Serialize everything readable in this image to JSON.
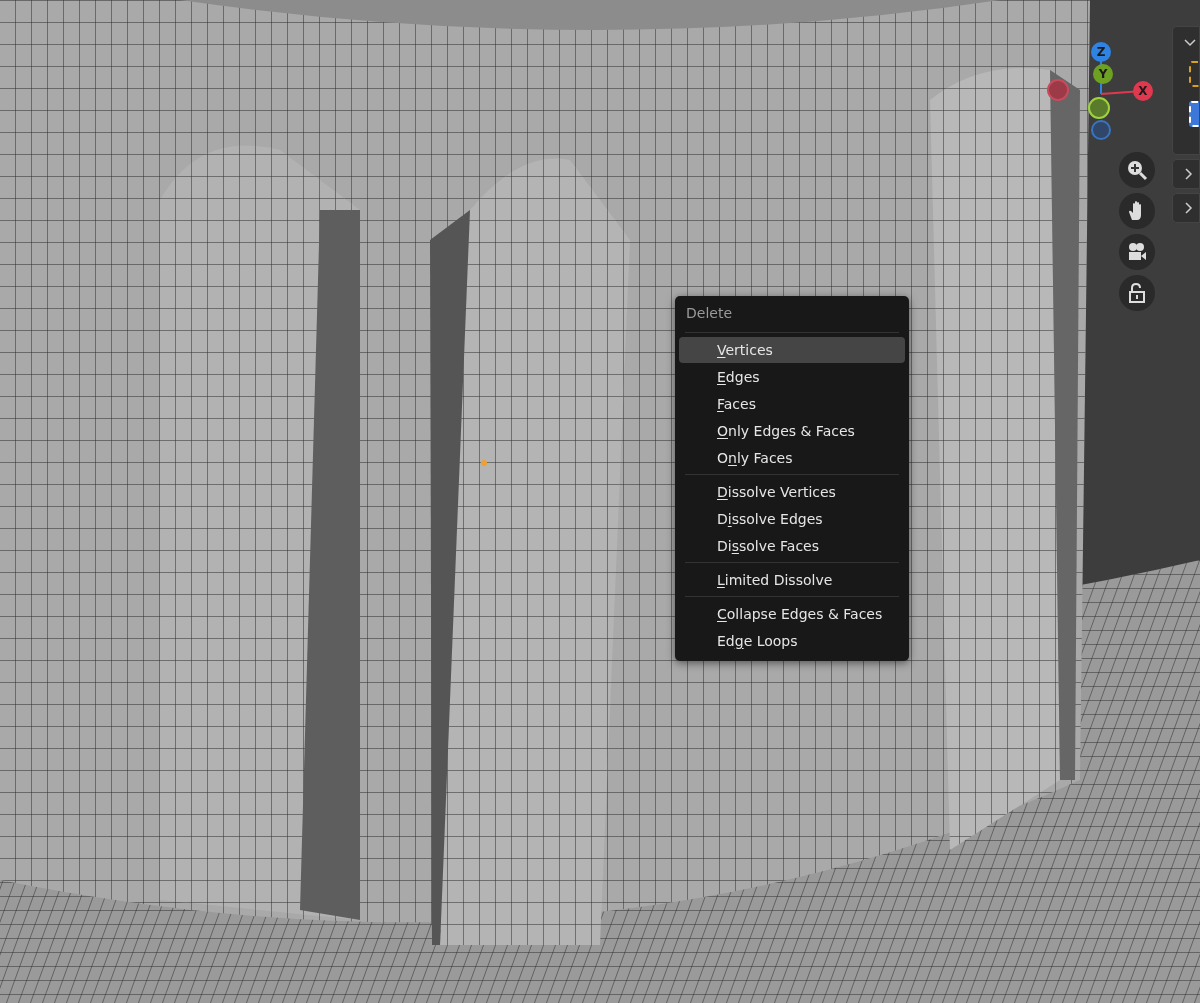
{
  "gizmo": {
    "axes": [
      {
        "label": "Z",
        "color": "#2f84e3"
      },
      {
        "label": "Y",
        "color": "#6ea123"
      },
      {
        "label": "X",
        "color": "#e0384f"
      }
    ]
  },
  "menu": {
    "title": "Delete",
    "groups": [
      {
        "items": [
          {
            "key": "V",
            "post": "ertices",
            "selected": true
          },
          {
            "key": "E",
            "post": "dges",
            "selected": false
          },
          {
            "key": "F",
            "post": "aces",
            "selected": false
          },
          {
            "key": "O",
            "post": "nly Edges & Faces",
            "selected": false
          },
          {
            "pre": "O",
            "key": "n",
            "post": "ly Faces",
            "selected": false
          }
        ]
      },
      {
        "items": [
          {
            "key": "D",
            "post": "issolve Vertices",
            "selected": false
          },
          {
            "pre": "D",
            "key": "i",
            "post": "ssolve Edges",
            "selected": false
          },
          {
            "pre": "Di",
            "key": "s",
            "post": "solve Faces",
            "selected": false
          }
        ]
      },
      {
        "items": [
          {
            "key": "L",
            "post": "imited Dissolve",
            "selected": false
          }
        ]
      },
      {
        "items": [
          {
            "key": "C",
            "post": "ollapse Edges & Faces",
            "selected": false
          },
          {
            "pre": "Ed",
            "key": "g",
            "post": "e Loops",
            "selected": false
          }
        ]
      }
    ]
  }
}
